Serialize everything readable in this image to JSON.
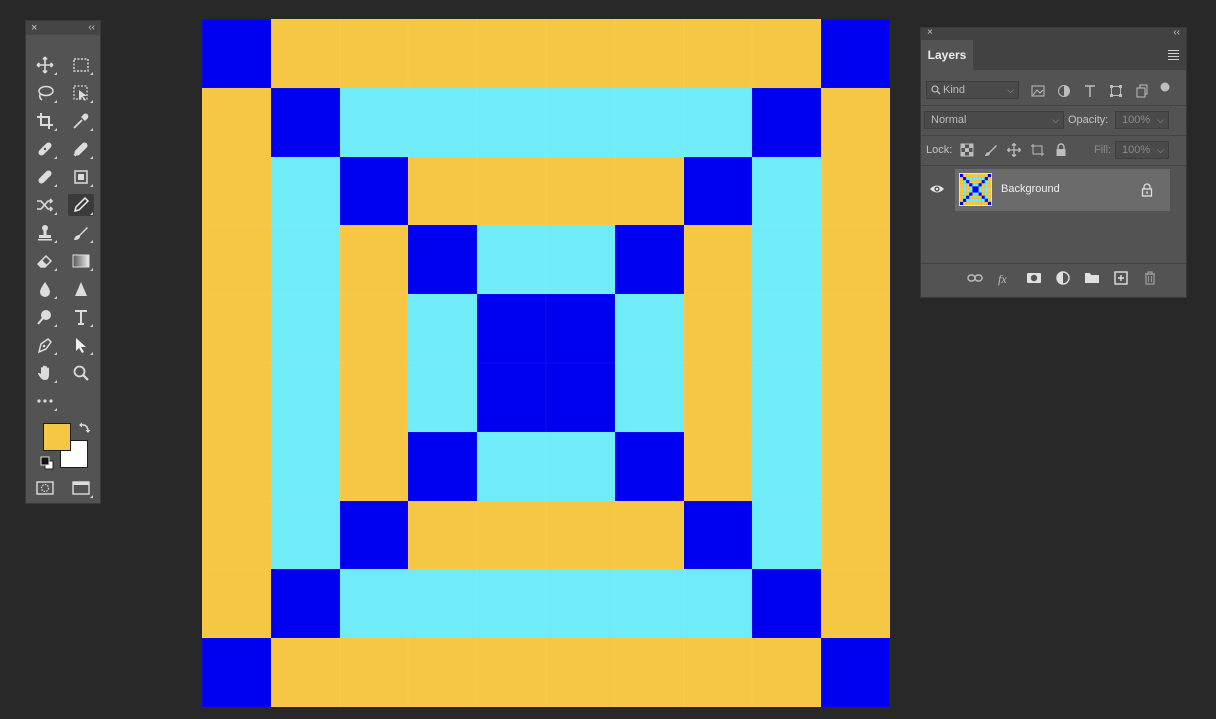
{
  "toolbar": {
    "close_label": "×",
    "collapse_label": "‹‹",
    "tools": [
      {
        "name": "move-tool",
        "icon": "move-icon"
      },
      {
        "name": "marquee-tool",
        "icon": "rect-marquee-icon"
      },
      {
        "name": "lasso-tool",
        "icon": "lasso-icon"
      },
      {
        "name": "object-select-tool",
        "icon": "object-select-icon"
      },
      {
        "name": "crop-tool",
        "icon": "crop-icon"
      },
      {
        "name": "eyedropper-tool",
        "icon": "eyedropper-icon"
      },
      {
        "name": "spot-healing-tool",
        "icon": "bandage-icon"
      },
      {
        "name": "healing-tool",
        "icon": "healing-icon"
      },
      {
        "name": "patch-tool",
        "icon": "patch-icon"
      },
      {
        "name": "content-aware-tool",
        "icon": "content-aware-icon"
      },
      {
        "name": "content-aware-move-tool",
        "icon": "shuffle-icon"
      },
      {
        "name": "pencil-tool",
        "icon": "pencil-icon",
        "active": true
      },
      {
        "name": "stamp-tool",
        "icon": "stamp-icon"
      },
      {
        "name": "history-brush-tool",
        "icon": "history-brush-icon"
      },
      {
        "name": "eraser-tool",
        "icon": "eraser-icon"
      },
      {
        "name": "gradient-tool",
        "icon": "gradient-icon"
      },
      {
        "name": "blur-tool",
        "icon": "drop-icon"
      },
      {
        "name": "sharpen-tool",
        "icon": "triangle-icon"
      },
      {
        "name": "dodge-tool",
        "icon": "dodge-icon"
      },
      {
        "name": "type-tool",
        "icon": "type-icon"
      },
      {
        "name": "pen-tool",
        "icon": "pen-icon"
      },
      {
        "name": "path-select-tool",
        "icon": "arrow-icon"
      },
      {
        "name": "hand-tool",
        "icon": "hand-icon"
      },
      {
        "name": "zoom-tool",
        "icon": "zoom-icon"
      },
      {
        "name": "more-tools",
        "icon": "ellipsis-icon"
      }
    ],
    "foreground_color": "#F6C744",
    "background_color": "#FFFFFF"
  },
  "canvas": {
    "colors": {
      "Y": "#F6C744",
      "B": "#0000F0",
      "C": "#6FECF8"
    },
    "rows": [
      "BYYYYYYYYB",
      "YBCCCCCCBY",
      "YCBYYYYBCY",
      "YCYBCCBYCY",
      "YCYCBBCYCY",
      "YCYCBBCYCY",
      "YCYBCCBYCY",
      "YCBYYYYBCY",
      "YBCCCCCCBY",
      "BYYYYYYYYB"
    ]
  },
  "layers_panel": {
    "close_label": "×",
    "collapse_label": "‹‹",
    "tab_label": "Layers",
    "kind_filter": "Kind",
    "blend_mode": "Normal",
    "opacity_label": "Opacity:",
    "opacity_value": "100%",
    "lock_label": "Lock:",
    "fill_label": "Fill:",
    "fill_value": "100%",
    "layers": [
      {
        "name": "Background",
        "visible": true,
        "locked": true
      }
    ]
  }
}
